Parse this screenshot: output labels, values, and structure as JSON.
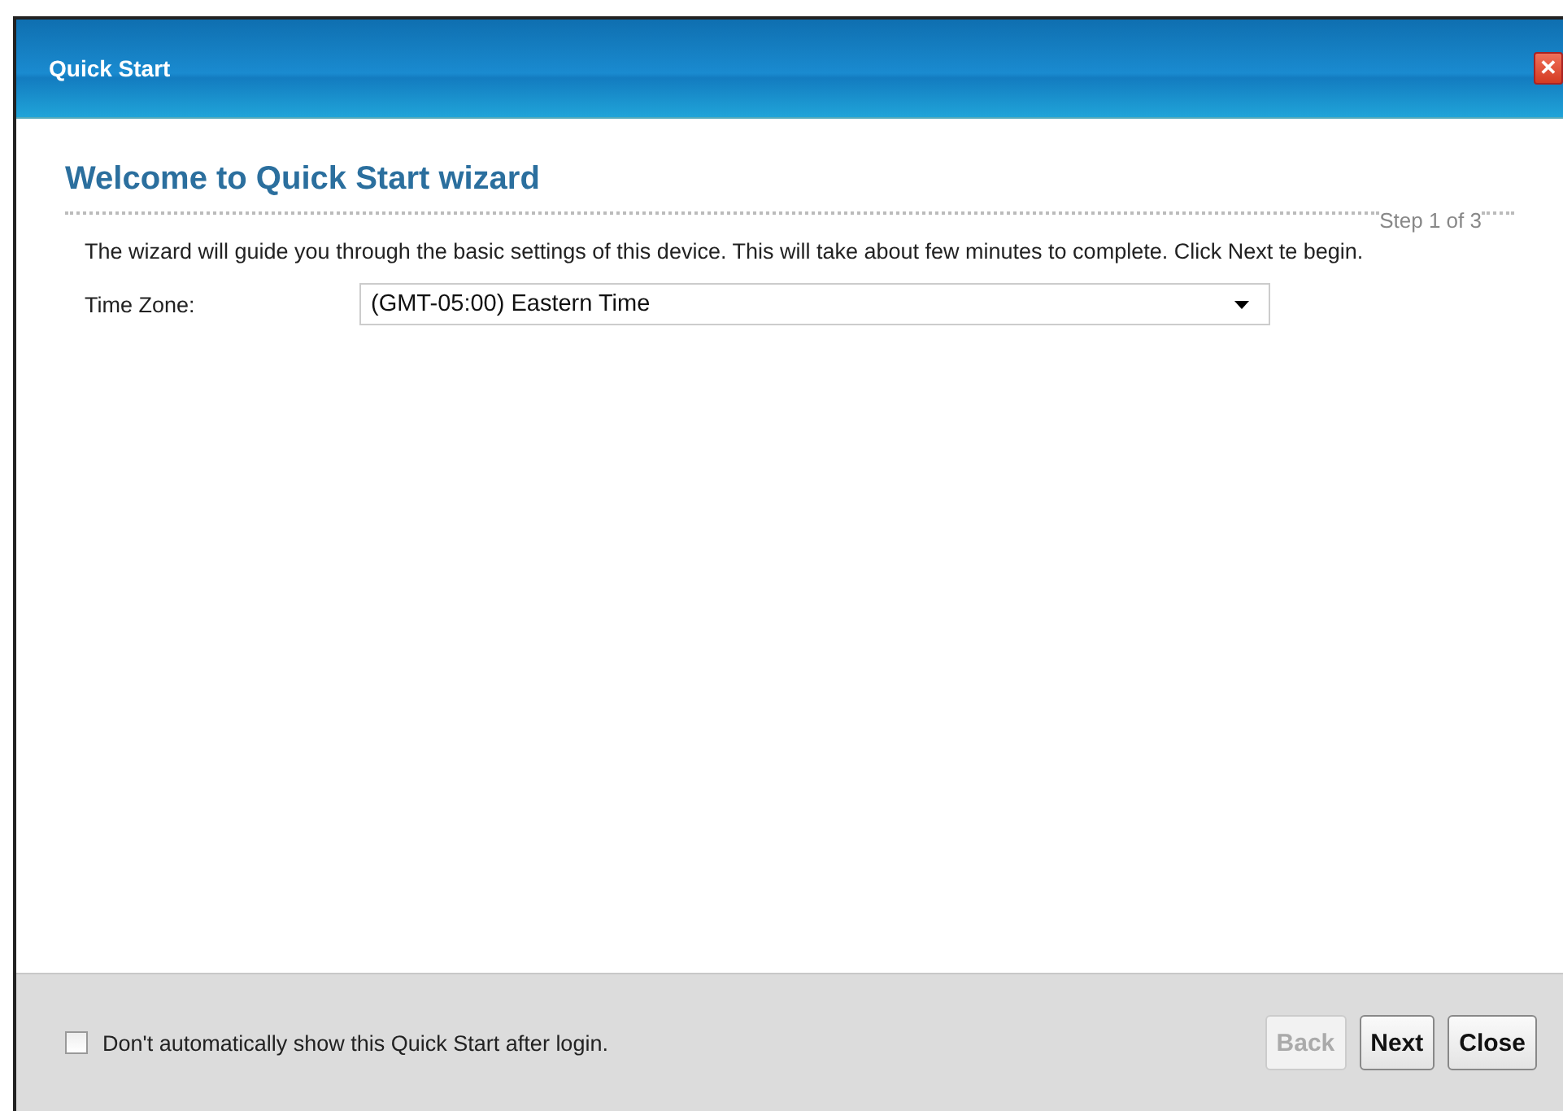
{
  "window": {
    "title": "Quick Start",
    "close": "✕"
  },
  "heading": "Welcome to Quick Start wizard",
  "step": "Step 1 of 3",
  "intro": "The wizard will guide you through the basic settings of this device. This will take about few minutes to complete. Click Next te begin.",
  "time_zone": {
    "label": "Time Zone:",
    "value": "(GMT-05:00) Eastern Time"
  },
  "footer": {
    "checkbox": {
      "label": "Don't automatically show this Quick Start after login.",
      "checked": false
    },
    "buttons": [
      {
        "label": "Back",
        "disabled": true
      },
      {
        "label": "Next",
        "disabled": false
      },
      {
        "label": "Close",
        "disabled": false
      }
    ]
  }
}
